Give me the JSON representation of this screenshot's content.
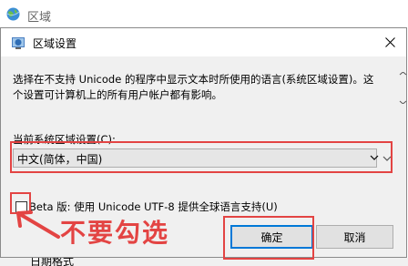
{
  "parent_window": {
    "title": "区域",
    "bottom_text": "日期格式"
  },
  "dialog": {
    "title": "区域设置",
    "description": "选择在不支持 Unicode 的程序中显示文本时所使用的语言(系统区域设置)。这个设置可计算机上的所有用户帐户都有影响。",
    "locale_label": "当前系统区域设置(C):",
    "locale_value": "中文(简体，中国)",
    "beta_label": "Beta 版: 使用 Unicode UTF-8 提供全球语言支持(U)",
    "beta_checked": false,
    "ok_label": "确定",
    "cancel_label": "取消"
  },
  "annotation": {
    "text": "不要勾选",
    "color": "#e34443"
  }
}
